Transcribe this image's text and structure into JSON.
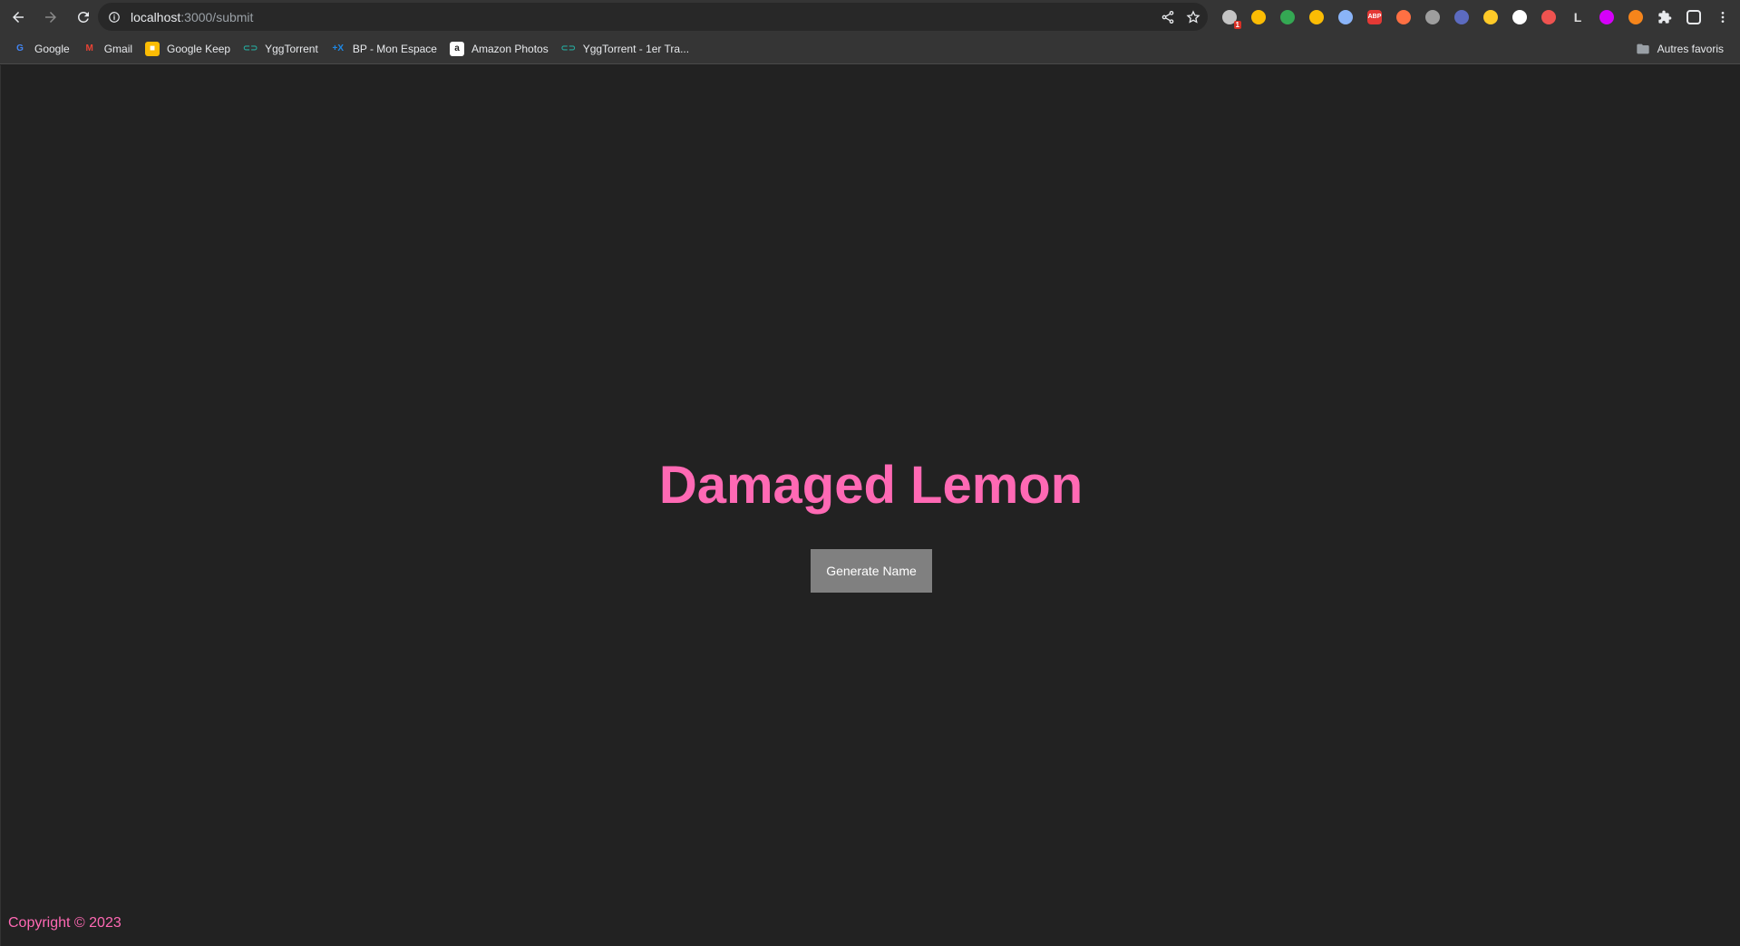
{
  "browser": {
    "url_host": "localhost",
    "url_path": ":3000/submit",
    "extensions": [
      {
        "name": "extension-badge-icon",
        "color": "#c4c4c4",
        "badge": "1"
      },
      {
        "name": "keep-extension-icon",
        "color": "#fbbc04"
      },
      {
        "name": "drive-icon",
        "color": "#34a853"
      },
      {
        "name": "lock-icon",
        "color": "#fbbc04"
      },
      {
        "name": "cloud-icon",
        "color": "#8ab4f8"
      },
      {
        "name": "abp-icon",
        "color": "#e53935",
        "text": "ABP"
      },
      {
        "name": "extension-icon",
        "color": "#ff7043"
      },
      {
        "name": "extension-icon",
        "color": "#9e9e9e"
      },
      {
        "name": "extension-icon",
        "color": "#5c6bc0"
      },
      {
        "name": "pen-icon",
        "color": "#ffca28"
      },
      {
        "name": "extension-icon",
        "color": "#ffffff"
      },
      {
        "name": "extension-icon",
        "color": "#ef5350"
      },
      {
        "name": "extension-icon",
        "color": "#212121",
        "text": "L"
      },
      {
        "name": "extension-icon",
        "color": "#d500f9"
      },
      {
        "name": "metamask-icon",
        "color": "#f6851b"
      },
      {
        "name": "puzzle-icon",
        "color": "#e8eaed"
      },
      {
        "name": "sidepanel-icon",
        "color": "#e8eaed"
      },
      {
        "name": "menu-icon",
        "color": "#e8eaed"
      }
    ],
    "bookmarks": [
      {
        "label": "Google",
        "icon": "google-icon",
        "color": "#4285f4",
        "glyph": "G"
      },
      {
        "label": "Gmail",
        "icon": "gmail-icon",
        "color": "#ea4335",
        "glyph": "M"
      },
      {
        "label": "Google Keep",
        "icon": "keep-icon",
        "color": "#fbbc04",
        "glyph": "■"
      },
      {
        "label": "YggTorrent",
        "icon": "ygg-icon",
        "color": "#26a69a",
        "glyph": "⊂⊃"
      },
      {
        "label": "BP - Mon Espace",
        "icon": "bp-icon",
        "color": "#1e88e5",
        "glyph": "+X"
      },
      {
        "label": "Amazon Photos",
        "icon": "amazon-icon",
        "color": "#ffffff",
        "glyph": "a"
      },
      {
        "label": "YggTorrent - 1er Tra...",
        "icon": "ygg-icon",
        "color": "#26a69a",
        "glyph": "⊂⊃"
      }
    ],
    "other_bookmarks": "Autres favoris"
  },
  "page": {
    "title": "Damaged Lemon",
    "button_label": "Generate Name",
    "footer": "Copyright © 2023"
  },
  "colors": {
    "accent": "#ff69b4",
    "background": "#222222",
    "button": "#808080"
  }
}
